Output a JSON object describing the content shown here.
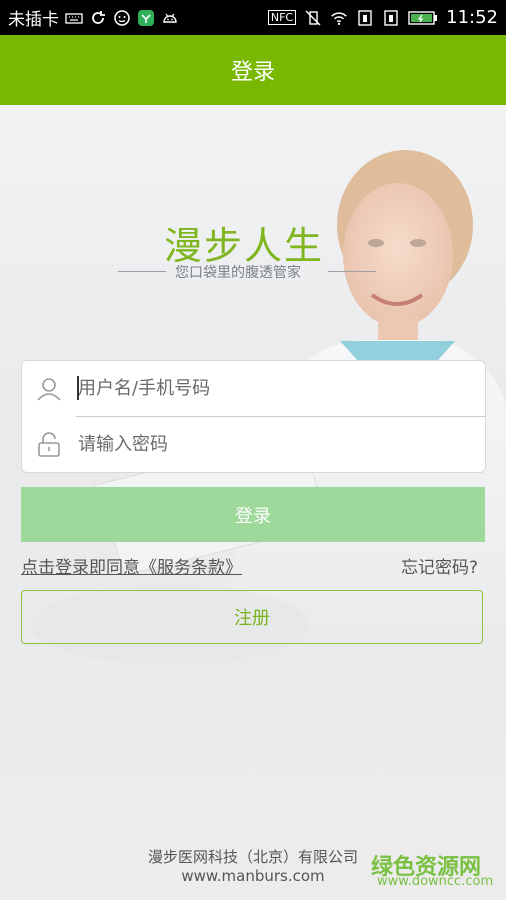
{
  "status_bar": {
    "carrier": "未插卡",
    "time": "11:52",
    "nfc_label": "NFC"
  },
  "header": {
    "title": "登录"
  },
  "brand": {
    "logo_text": "漫步人生",
    "slogan": "您口袋里的腹透管家"
  },
  "form": {
    "username_placeholder": "用户名/手机号码",
    "password_placeholder": "请输入密码"
  },
  "buttons": {
    "login_label": "登录",
    "register_label": "注册"
  },
  "links": {
    "agree_text": "点击登录即同意《服务条款》",
    "forgot_text": "忘记密码?"
  },
  "footer": {
    "company": "漫步医网科技（北京）有限公司",
    "website": "www.manburs.com"
  },
  "watermark": {
    "title": "绿色资源网",
    "url": "www.downcc.com"
  },
  "colors": {
    "brand_green": "#78b800",
    "login_button": "#9ed89b",
    "register_border": "#8cc240"
  }
}
